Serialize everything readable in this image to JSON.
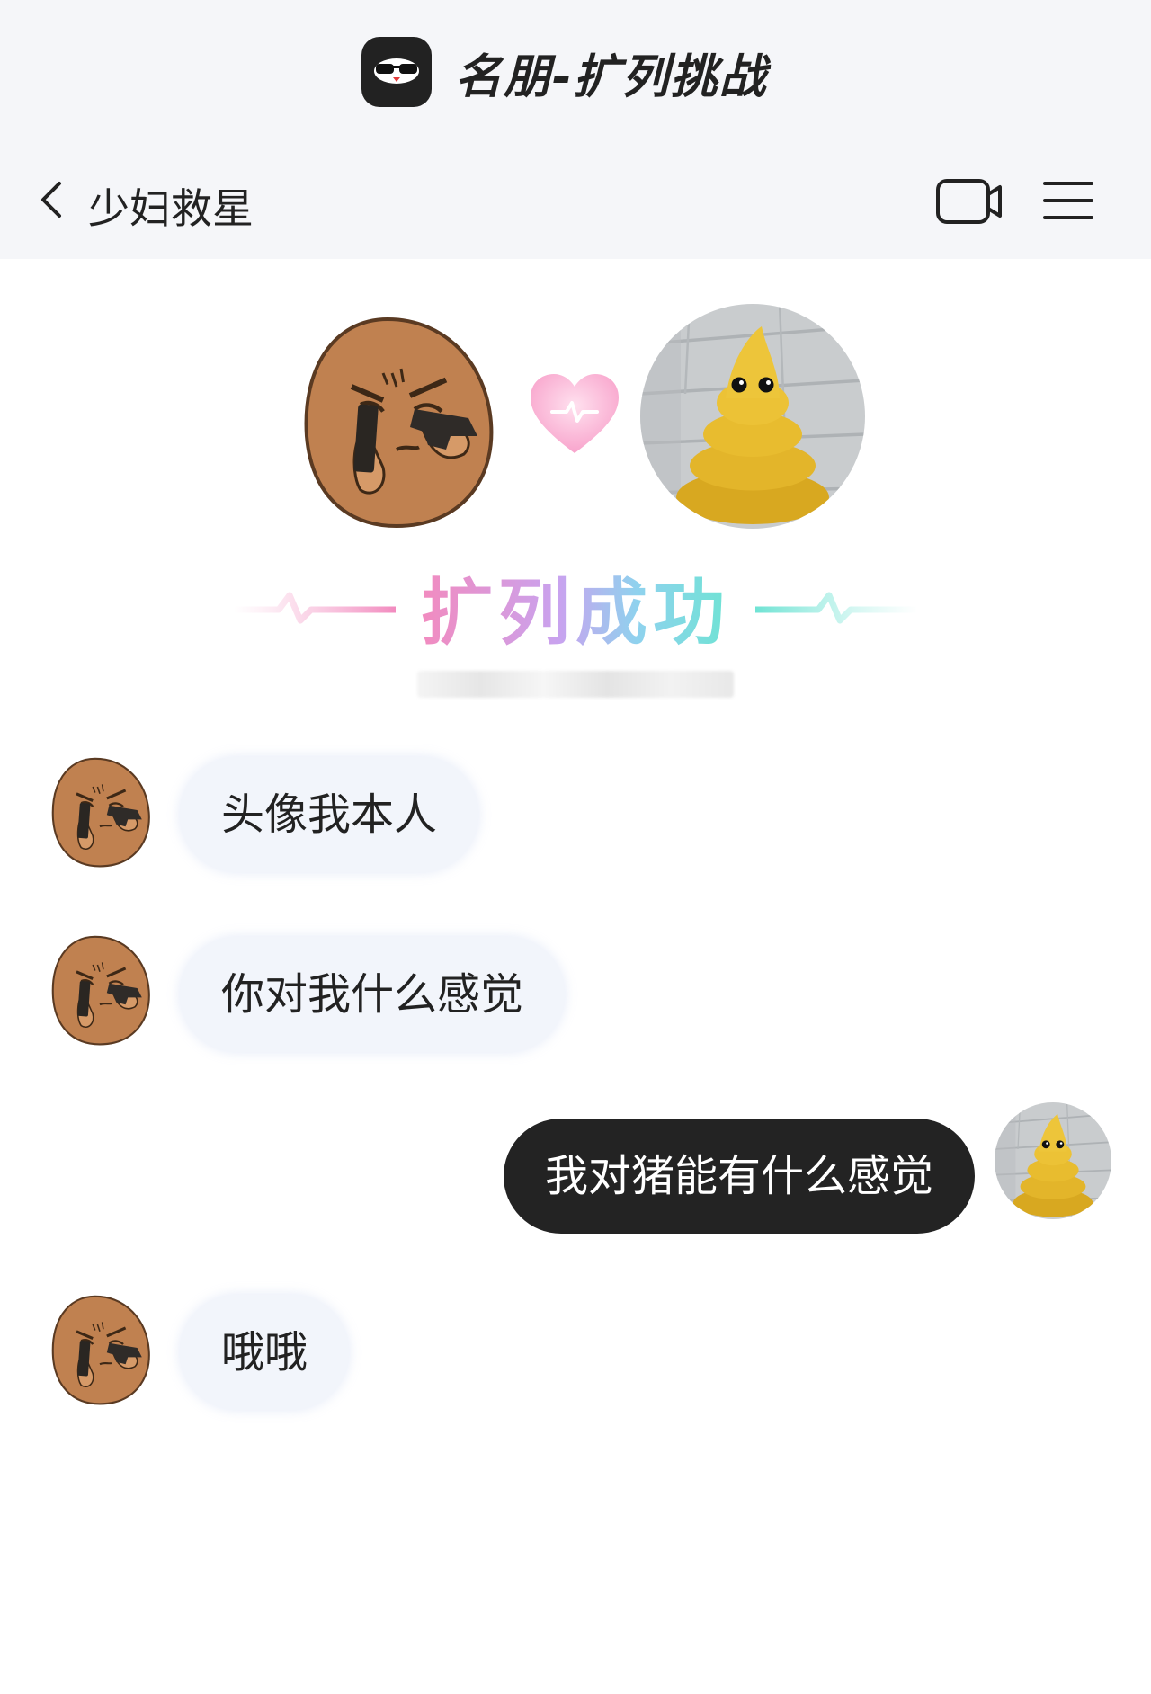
{
  "app": {
    "name": "名朋-扩列挑战",
    "logo_icon": "sunglasses-face-icon"
  },
  "nav": {
    "title": "少妇救星",
    "back_icon": "chevron-left-icon",
    "video_icon": "video-camera-icon",
    "menu_icon": "hamburger-menu-icon"
  },
  "match": {
    "label": "扩列成功",
    "heart_icon": "heart-pulse-icon"
  },
  "messages": [
    {
      "from": "other",
      "text": "头像我本人"
    },
    {
      "from": "other",
      "text": "你对我什么感觉"
    },
    {
      "from": "me",
      "text": "我对猪能有什么感觉"
    },
    {
      "from": "other",
      "text": "哦哦"
    }
  ],
  "colors": {
    "bubble_in": "#f2f5fb",
    "bubble_out": "#232323",
    "header_bg": "#f5f6f9",
    "match_pink": "#f28bbf",
    "match_cyan": "#6fe3d4"
  }
}
